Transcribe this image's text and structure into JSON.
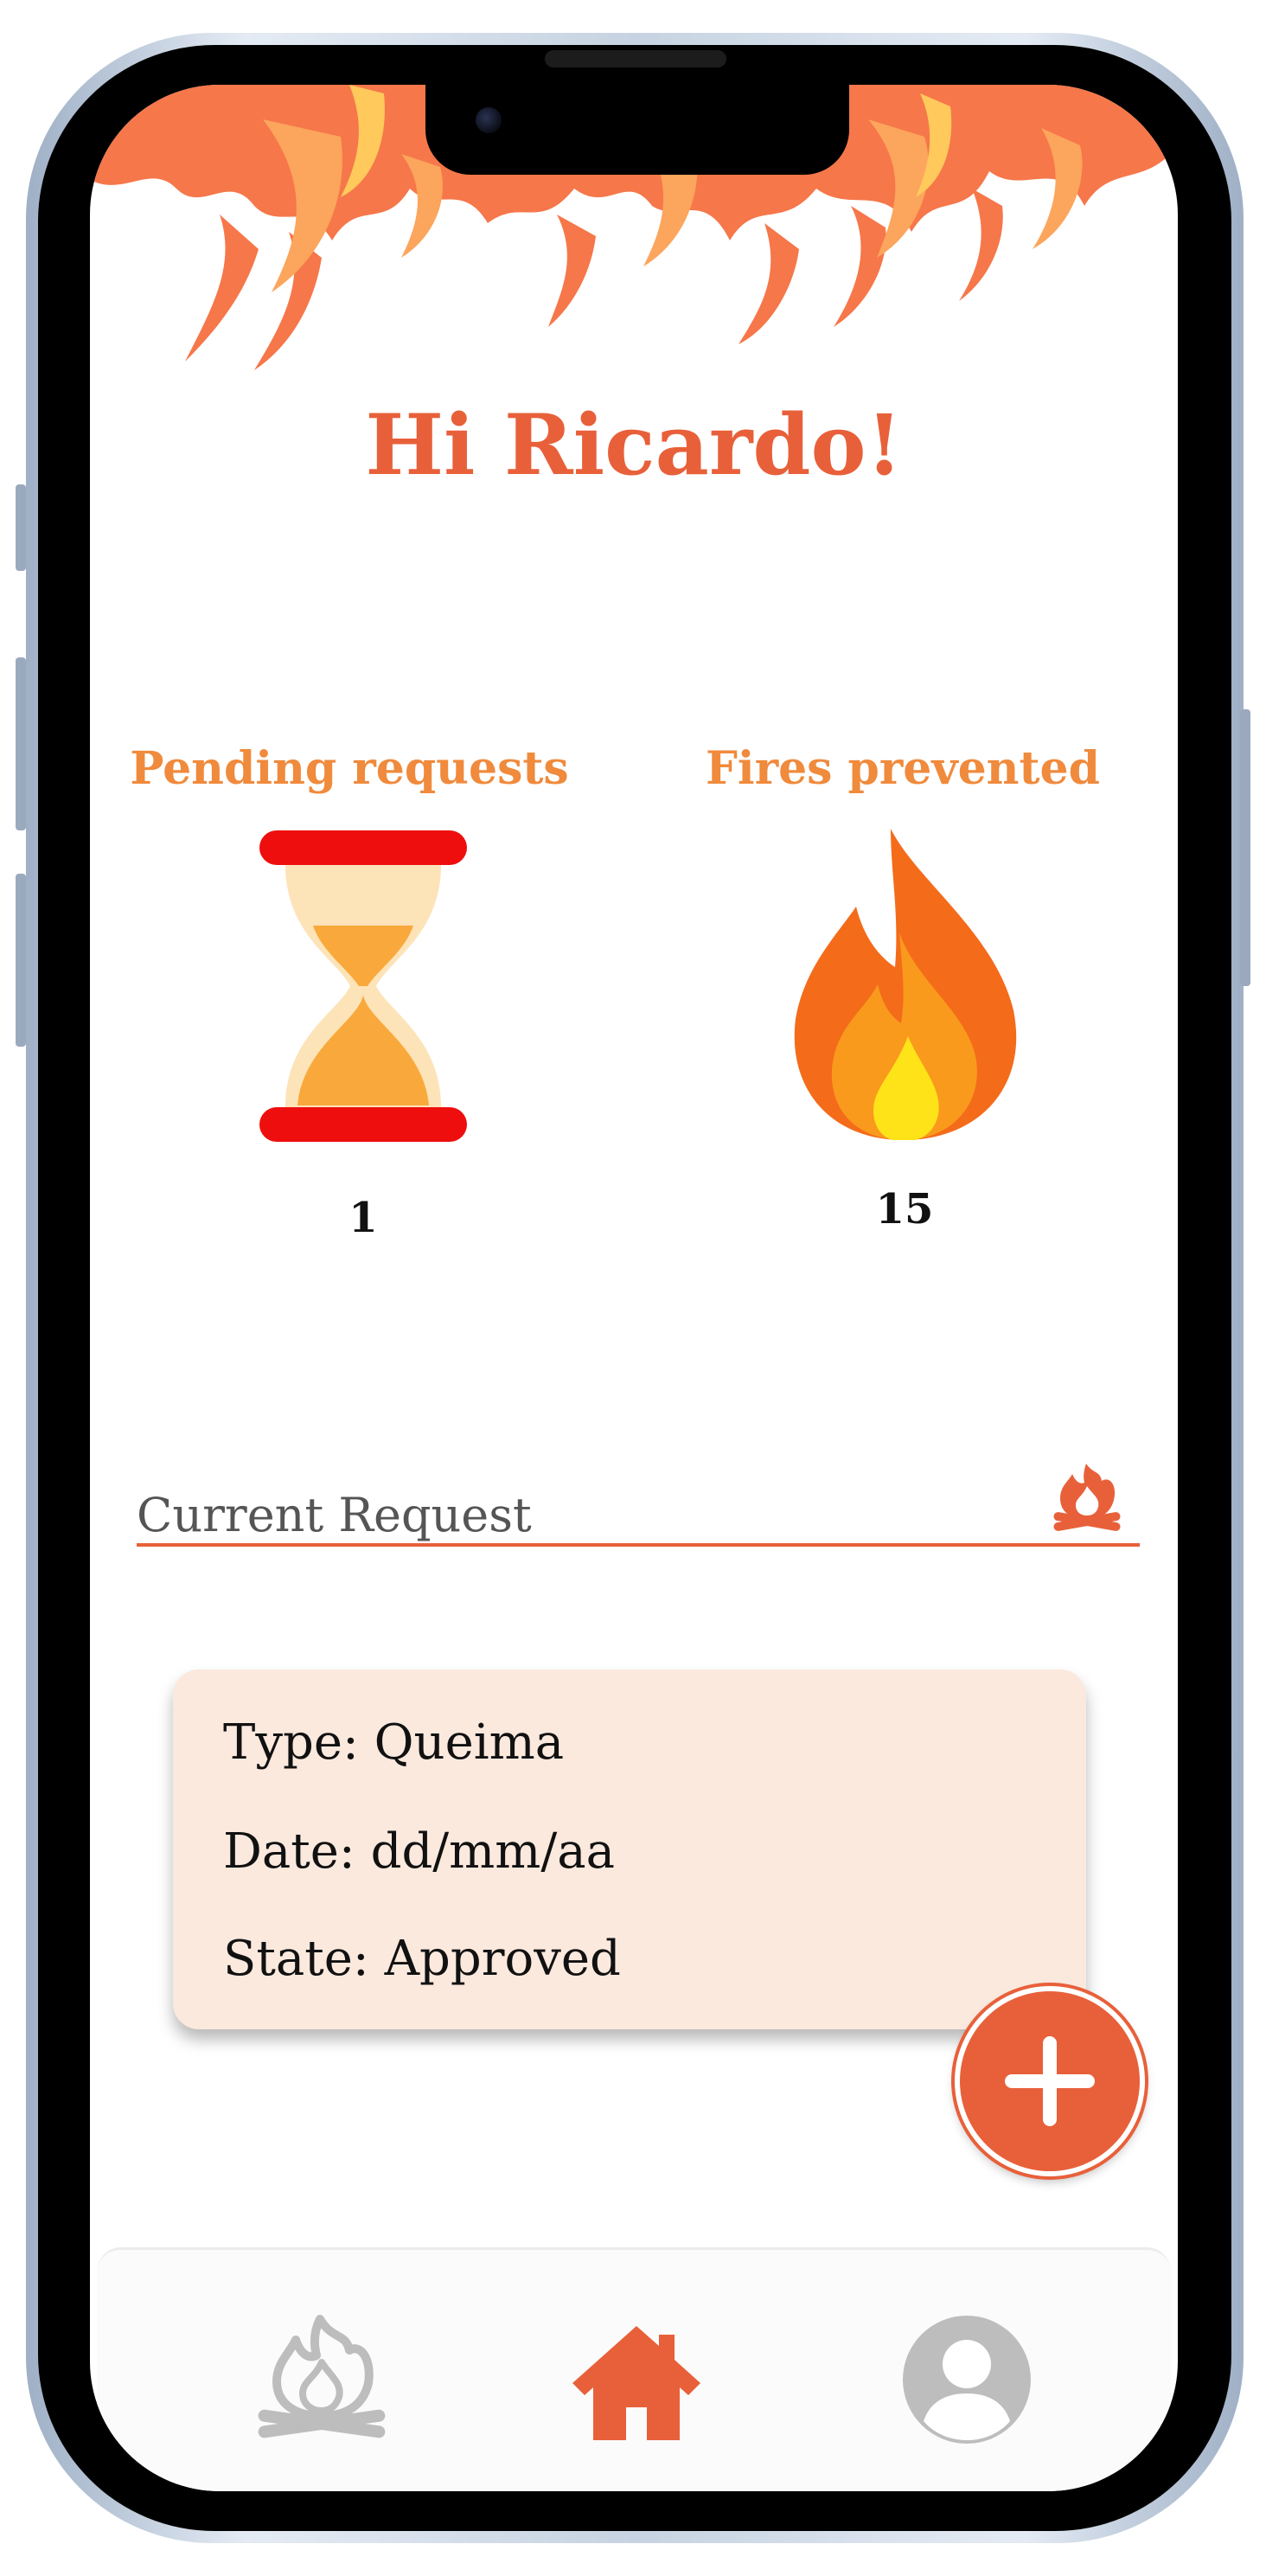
{
  "header": {
    "greeting": "Hi Ricardo!"
  },
  "stats": {
    "pending": {
      "label": "Pending requests",
      "value": "1",
      "icon": "hourglass-icon"
    },
    "prevented": {
      "label": "Fires prevented",
      "value": "15",
      "icon": "fire-icon"
    }
  },
  "current_request": {
    "section_label": "Current Request",
    "section_icon": "campfire-icon",
    "type_line": "Type: Queima",
    "date_line": "Date: dd/mm/aa",
    "state_line": "State: Approved"
  },
  "fab": {
    "icon": "plus-icon"
  },
  "nav": {
    "items": [
      {
        "name": "campfire",
        "icon": "campfire-icon",
        "active": false
      },
      {
        "name": "home",
        "icon": "home-icon",
        "active": true
      },
      {
        "name": "profile",
        "icon": "user-icon",
        "active": false
      }
    ]
  },
  "colors": {
    "accent": "#e8603a",
    "stat_label": "#f08a3c",
    "card_bg": "#fbe9de",
    "nav_inactive": "#bdbdbd"
  }
}
